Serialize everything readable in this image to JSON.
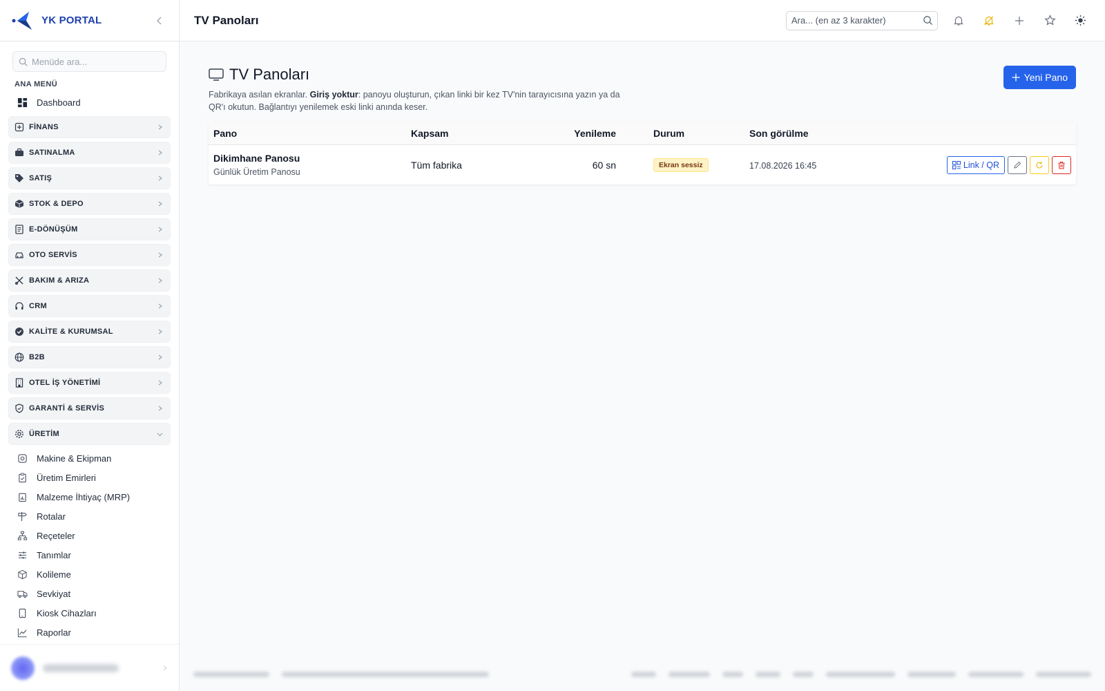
{
  "brand": {
    "name": "YK PORTAL"
  },
  "menu_search": {
    "placeholder": "Menüde ara..."
  },
  "section_label": "ANA MENÜ",
  "dashboard_label": "Dashboard",
  "groups": [
    {
      "label": "FİNANS",
      "icon": "finance-icon"
    },
    {
      "label": "SATINALMA",
      "icon": "briefcase-icon"
    },
    {
      "label": "SATIŞ",
      "icon": "tag-icon"
    },
    {
      "label": "STOK & DEPO",
      "icon": "box-icon"
    },
    {
      "label": "E-DÖNÜŞÜM",
      "icon": "document-icon"
    },
    {
      "label": "OTO SERVİS",
      "icon": "car-icon"
    },
    {
      "label": "BAKIM & ARIZA",
      "icon": "tools-icon"
    },
    {
      "label": "CRM",
      "icon": "headset-icon"
    },
    {
      "label": "KALİTE & KURUMSAL",
      "icon": "badge-check-icon"
    },
    {
      "label": "B2B",
      "icon": "globe-icon"
    },
    {
      "label": "OTEL İŞ YÖNETİMİ",
      "icon": "building-icon"
    },
    {
      "label": "GARANTİ & SERVİS",
      "icon": "shield-icon"
    },
    {
      "label": "ÜRETİM",
      "icon": "gear-icon"
    }
  ],
  "production_items": [
    "Makine & Ekipman",
    "Üretim Emirleri",
    "Malzeme İhtiyaç (MRP)",
    "Rotalar",
    "Reçeteler",
    "Tanımlar",
    "Kolileme",
    "Sevkiyat",
    "Kiosk Cihazları",
    "Raporlar"
  ],
  "topbar": {
    "title": "TV Panoları",
    "search_placeholder": "Ara... (en az 3 karakter)"
  },
  "page": {
    "title": "TV Panoları",
    "desc_pre": "Fabrikaya asılan ekranlar. ",
    "desc_bold": "Giriş yoktur",
    "desc_post": ": panoyu oluşturun, çıkan linki bir kez TV'nin tarayıcısına yazın ya da QR'ı okutun. Bağlantıyı yenilemek eski linki anında keser.",
    "new_button": "Yeni Pano"
  },
  "table": {
    "headers": {
      "pano": "Pano",
      "kapsam": "Kapsam",
      "yenileme": "Yenileme",
      "durum": "Durum",
      "son": "Son görülme"
    },
    "rows": [
      {
        "name": "Dikimhane Panosu",
        "sub": "Günlük Üretim Panosu",
        "kapsam": "Tüm fabrika",
        "yenileme": "60 sn",
        "durum": "Ekran sessiz",
        "son": "17.08.2026 16:45",
        "link_label": "Link / QR"
      }
    ]
  },
  "colors": {
    "accent": "#2563eb",
    "brand": "#1e40af",
    "warning_bg": "#fef3c7",
    "danger": "#dc2626",
    "alert_icon": "#eab308"
  }
}
